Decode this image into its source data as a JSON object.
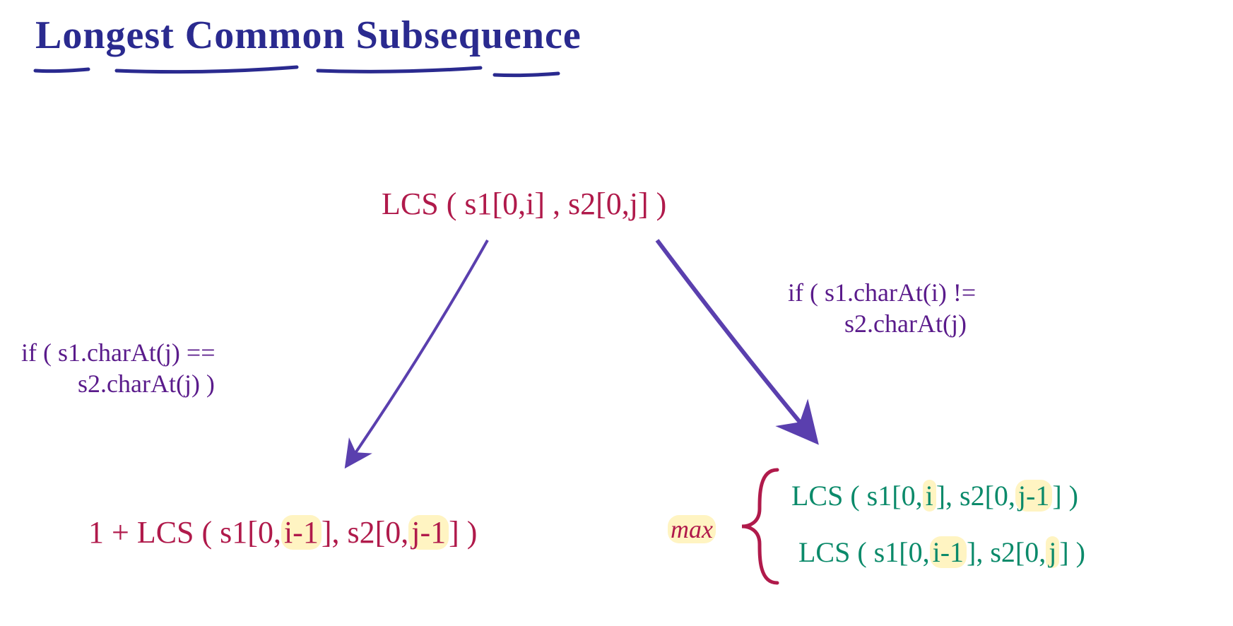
{
  "title": "Longest Common Subsequence",
  "root": "LCS ( s1[0,i] , s2[0,j] )",
  "left_condition_line1": "if ( s1.charAt(j) ==",
  "left_condition_line2": "s2.charAt(j) )",
  "right_condition_line1": "if ( s1.charAt(i) !=",
  "right_condition_line2": "s2.charAt(j)",
  "left_result_prefix": "1 + LCS ( s1[0,",
  "left_result_mid1": "i-1",
  "left_result_mid2": "], s2[0,",
  "left_result_mid3": "j-1",
  "left_result_suffix": "] )",
  "max_label": "max",
  "right_result_1_a": "LCS ( s1[0,",
  "right_result_1_b": "i",
  "right_result_1_c": "], s2[0,",
  "right_result_1_d": "j-1",
  "right_result_1_e": "] )",
  "right_result_2_a": "LCS ( s1[0,",
  "right_result_2_b": "i-1",
  "right_result_2_c": "], s2[0,",
  "right_result_2_d": "j",
  "right_result_2_e": "] )",
  "colors": {
    "title": "#2a2a8f",
    "formula_red": "#b01a4b",
    "condition_purple": "#5a1b8b",
    "result_green": "#0b8a6a",
    "highlight": "#fff4c2"
  }
}
